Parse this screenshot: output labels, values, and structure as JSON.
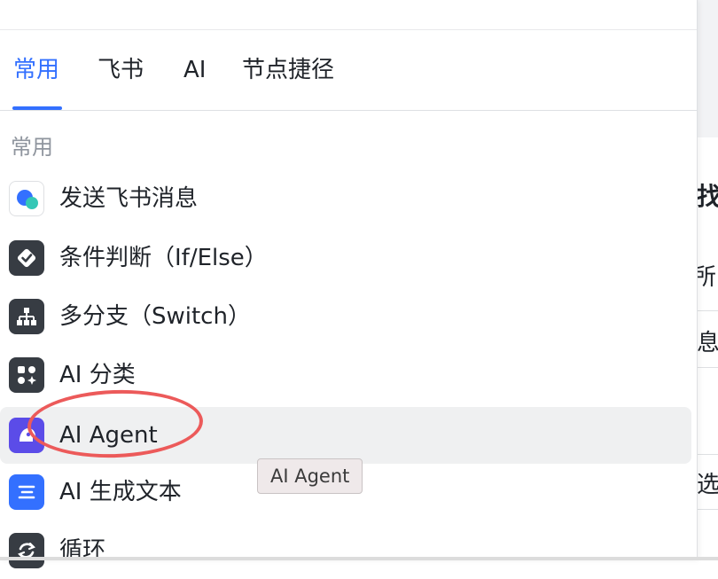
{
  "tabs": [
    {
      "label": "常用",
      "active": true
    },
    {
      "label": "飞书",
      "active": false
    },
    {
      "label": "AI",
      "active": false
    },
    {
      "label": "节点捷径",
      "active": false
    }
  ],
  "section_title": "常用",
  "items": [
    {
      "label": "发送飞书消息",
      "icon": "feishu-message-icon"
    },
    {
      "label": "条件判断（If/Else）",
      "icon": "condition-check-icon"
    },
    {
      "label": "多分支（Switch）",
      "icon": "branch-tree-icon"
    },
    {
      "label": "AI 分类",
      "icon": "ai-classify-icon"
    },
    {
      "label": "AI Agent",
      "icon": "ai-agent-icon",
      "hovered": true
    },
    {
      "label": "AI 生成文本",
      "icon": "text-generate-icon"
    },
    {
      "label": "循环",
      "icon": "loop-icon"
    }
  ],
  "tooltip": "AI Agent",
  "background_fragments": [
    "找",
    "所",
    "息",
    "选"
  ],
  "colors": {
    "accent": "#3370ff",
    "annotation": "#ec5a5a",
    "hover_bg": "#eff0f1"
  }
}
